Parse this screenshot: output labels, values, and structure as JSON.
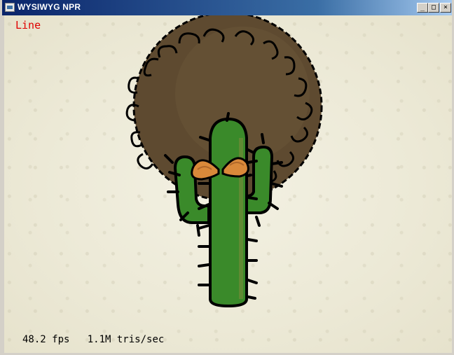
{
  "window": {
    "title": "WYSIWYG NPR",
    "buttons": {
      "minimize": "_",
      "maximize": "□",
      "close": "×"
    }
  },
  "overlay": {
    "mode": "Line",
    "fps": "48.2 fps",
    "tris": "1.1M tris/sec"
  },
  "icons": {
    "app": "app-window-icon",
    "minimize": "minimize-icon",
    "maximize": "maximize-icon",
    "close": "close-icon"
  },
  "colors": {
    "mode_label": "#e00000",
    "paper": "#ece9d6",
    "cactus": "#3a8a2a",
    "afro": "#5e4a30",
    "mustache": "#d9893a"
  }
}
